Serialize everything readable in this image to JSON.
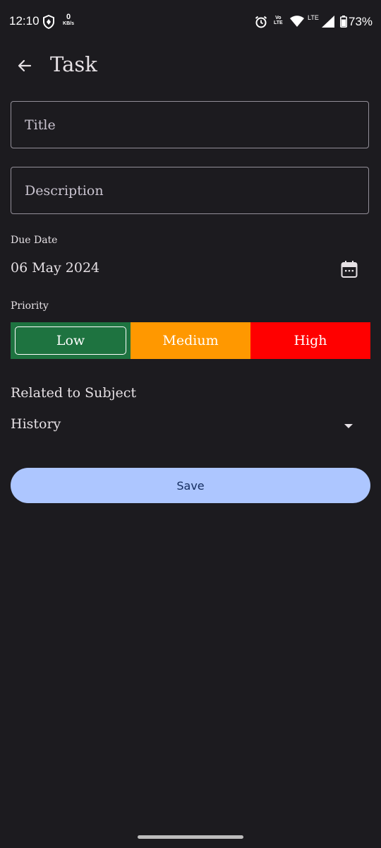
{
  "status_bar": {
    "time": "12:10",
    "net_speed_value": "0",
    "net_speed_unit": "KB/s",
    "volte_line1": "Vo",
    "volte_line2": "LTE",
    "lte_label": "LTE",
    "battery_percent": "73%",
    "icons": [
      "shield-icon",
      "alarm-icon",
      "wifi-icon",
      "signal-icon",
      "battery-icon"
    ]
  },
  "app_bar": {
    "title": "Task",
    "back_icon": "arrow-back-icon"
  },
  "form": {
    "title_placeholder": "Title",
    "title_value": "",
    "description_placeholder": "Description",
    "description_value": "",
    "due_date_label": "Due Date",
    "due_date_value": "06 May 2024",
    "calendar_icon": "calendar-icon",
    "priority_label": "Priority",
    "priority_options": [
      {
        "label": "Low",
        "color": "#1e7340",
        "selected": true
      },
      {
        "label": "Medium",
        "color": "#ff9800",
        "selected": false
      },
      {
        "label": "High",
        "color": "#ff0000",
        "selected": false
      }
    ],
    "related_label": "Related to Subject",
    "subject_value": "History",
    "dropdown_icon": "arrow-drop-down-icon",
    "save_label": "Save"
  },
  "colors": {
    "background": "#1c1b1f",
    "save_button": "#adc6ff",
    "save_text": "#152e60"
  }
}
